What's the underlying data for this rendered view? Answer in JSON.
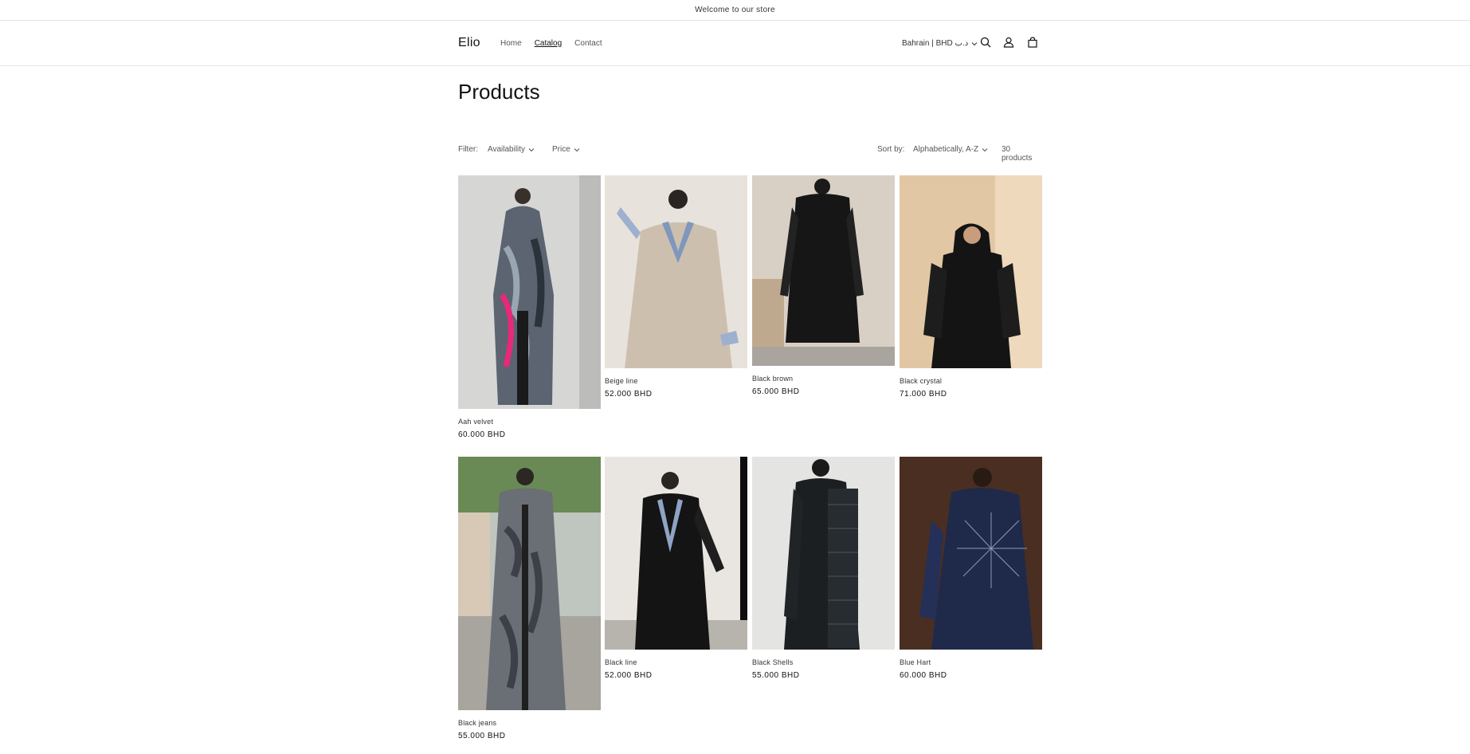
{
  "announcement": "Welcome to our store",
  "header": {
    "logo": "Elio",
    "nav": [
      "Home",
      "Catalog",
      "Contact"
    ],
    "country": "Bahrain | BHD د.ب"
  },
  "page_title": "Products",
  "facets": {
    "filter_label": "Filter:",
    "availability": "Availability",
    "price": "Price",
    "sort_label": "Sort by:",
    "sort_value": "Alphabetically, A-Z",
    "count": "30 products"
  },
  "products": [
    {
      "title": "Aah velvet",
      "price": "60.000 BHD"
    },
    {
      "title": "Beige line",
      "price": "52.000 BHD"
    },
    {
      "title": "Black brown",
      "price": "65.000 BHD"
    },
    {
      "title": "Black crystal",
      "price": "71.000 BHD"
    },
    {
      "title": "Black jeans",
      "price": "55.000 BHD"
    },
    {
      "title": "Black line",
      "price": "52.000 BHD"
    },
    {
      "title": "Black Shells",
      "price": "55.000 BHD"
    },
    {
      "title": "Blue Hart",
      "price": "60.000 BHD"
    }
  ]
}
